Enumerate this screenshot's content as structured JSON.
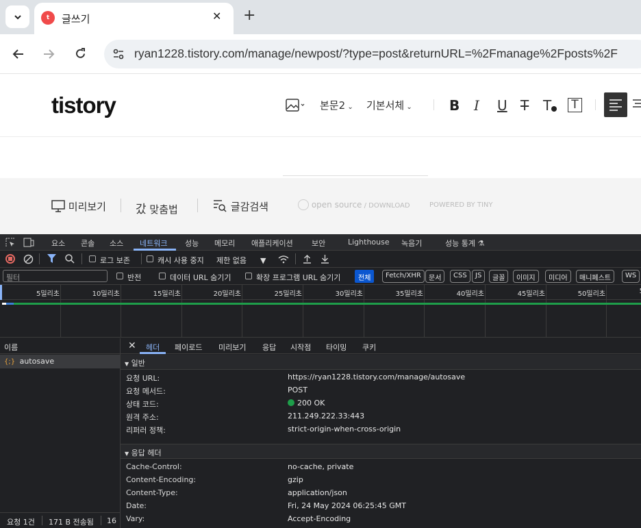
{
  "browser": {
    "tab_title": "글쓰기",
    "tab_favicon_letter": "t",
    "url": "ryan1228.tistory.com/manage/newpost/?type=post&returnURL=%2Fmanage%2Fposts%2F"
  },
  "editor": {
    "logo": "tistory",
    "toolbar": {
      "paragraph_style": "본문2",
      "font": "기본서체",
      "bold": "B",
      "italic": "I",
      "underline": "U",
      "strike": "T",
      "text_color": "T",
      "bg_color": "T"
    }
  },
  "bottom_bar": {
    "preview": "미리보기",
    "spellcheck": "맞춤법",
    "material_search": "글감검색",
    "opensource": "open source",
    "download": " / DOWNLOAD",
    "powered": "POWERED BY TINY"
  },
  "devtools": {
    "tabs": [
      "요소",
      "콘솔",
      "소스",
      "네트워크",
      "성능",
      "메모리",
      "애플리케이션",
      "보안",
      "Lighthouse",
      "녹음기",
      "성능 통계"
    ],
    "active_tab": "네트워크",
    "toolbar": {
      "preserve_log": "로그 보존",
      "disable_cache": "캐시 사용 중지",
      "throttle": "제한 없음"
    },
    "filter_bar": {
      "filter_placeholder": "필터",
      "invert": "반전",
      "hide_data_urls": "데이터 URL 숨기기",
      "hide_extension_urls": "확장 프로그램 URL 숨기기",
      "types": [
        "전체",
        "Fetch/XHR",
        "문서",
        "CSS",
        "JS",
        "글꼴",
        "이미지",
        "미디어",
        "매니페스트",
        "WS"
      ],
      "selected_type": "전체"
    },
    "timeline_ticks": [
      "5밀리초",
      "10밀리초",
      "15밀리초",
      "20밀리초",
      "25밀리초",
      "30밀리초",
      "35밀리초",
      "40밀리초",
      "45밀리초",
      "50밀리초",
      "5"
    ],
    "request_list": {
      "header": "이름",
      "requests": [
        {
          "name": "autosave",
          "icon": "{;}"
        }
      ],
      "status": {
        "requests": "요청 1건",
        "transferred": "171 B 전송됨",
        "more": "16"
      }
    },
    "details": {
      "tabs": [
        "헤더",
        "페이로드",
        "미리보기",
        "응답",
        "시작점",
        "타이밍",
        "쿠키"
      ],
      "active_tab": "헤더",
      "general_title": "일반",
      "general": [
        {
          "key": "요청 URL:",
          "value": "https://ryan1228.tistory.com/manage/autosave"
        },
        {
          "key": "요청 메서드:",
          "value": "POST"
        },
        {
          "key": "상태 코드:",
          "value": "200 OK"
        },
        {
          "key": "원격 주소:",
          "value": "211.249.222.33:443"
        },
        {
          "key": "리퍼러 정책:",
          "value": "strict-origin-when-cross-origin"
        }
      ],
      "response_headers_title": "응답 헤더",
      "response_headers": [
        {
          "key": "Cache-Control:",
          "value": "no-cache, private"
        },
        {
          "key": "Content-Encoding:",
          "value": "gzip"
        },
        {
          "key": "Content-Type:",
          "value": "application/json"
        },
        {
          "key": "Date:",
          "value": "Fri, 24 May 2024 06:25:45 GMT"
        },
        {
          "key": "Vary:",
          "value": "Accept-Encoding"
        }
      ]
    }
  },
  "colors": {
    "status_ok": "#1e9e4a",
    "devtools_accent": "#8ab4f8",
    "record_red": "#e46962"
  }
}
